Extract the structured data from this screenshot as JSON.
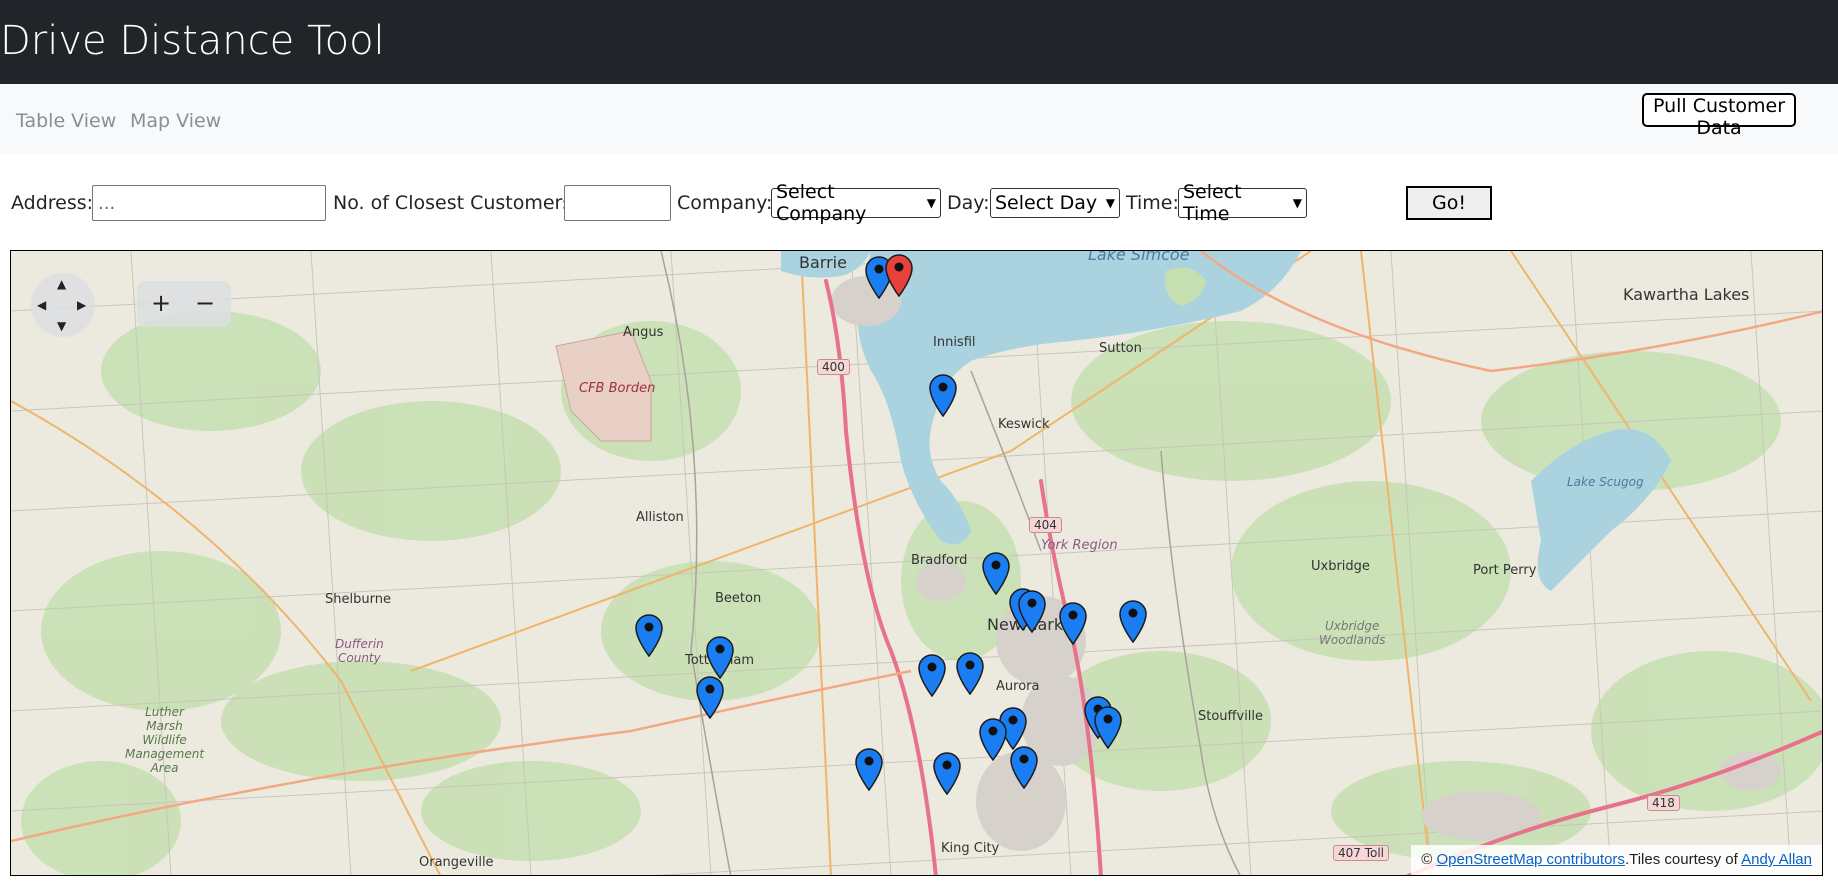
{
  "app": {
    "title": "Drive Distance Tool"
  },
  "nav": {
    "table_view": "Table View",
    "map_view": "Map View",
    "pull_button": "Pull Customer Data"
  },
  "form": {
    "address_label": "Address:",
    "address_placeholder": "...",
    "closest_label": "No. of Closest Customers:",
    "closest_value": "",
    "company_label": "Company:",
    "company_selected": "Select Company",
    "day_label": "Day:",
    "day_selected": "Select Day",
    "time_label": "Time:",
    "time_selected": "Time",
    "time_selected_full": "Select Time",
    "go_button": "Go!"
  },
  "map": {
    "pan_icon": "pan-arrows-icon",
    "zoom_in": "+",
    "zoom_out": "−",
    "attribution_prefix": "©",
    "attribution_osm": "OpenStreetMap contributors",
    "attribution_mid": ".Tiles courtesy of",
    "attribution_author": "Andy Allan",
    "places": {
      "barrie": "Barrie",
      "lake_simcoe": "Lake Simcoe",
      "angus": "Angus",
      "innisfil": "Innisfil",
      "sutton": "Sutton",
      "kawartha": "Kawartha Lakes",
      "cfb_borden": "CFB Borden",
      "keswick": "Keswick",
      "lake_scugog": "Lake Scugog",
      "alliston": "Alliston",
      "york_region": "York Region",
      "bradford": "Bradford",
      "uxbridge": "Uxbridge",
      "port_perry": "Port Perry",
      "shelburne": "Shelburne",
      "beeton": "Beeton",
      "newmarket": "Newmarket",
      "uxbridge_woodlands": "Uxbridge\nWoodlands",
      "dufferin": "Dufferin\nCounty",
      "tottenham": "Tottenham",
      "aurora": "Aurora",
      "stouffville": "Stouffville",
      "luther": "Luther\nMarsh\nWildlife\nManagement\nArea",
      "orangeville": "Orangeville",
      "king_city": "King City"
    },
    "shields": {
      "h400": "400",
      "h404": "404",
      "h418": "418",
      "h407": "407 Toll"
    },
    "marker_colors": {
      "customer": "#1a7ef2",
      "origin": "#e8413c"
    }
  }
}
